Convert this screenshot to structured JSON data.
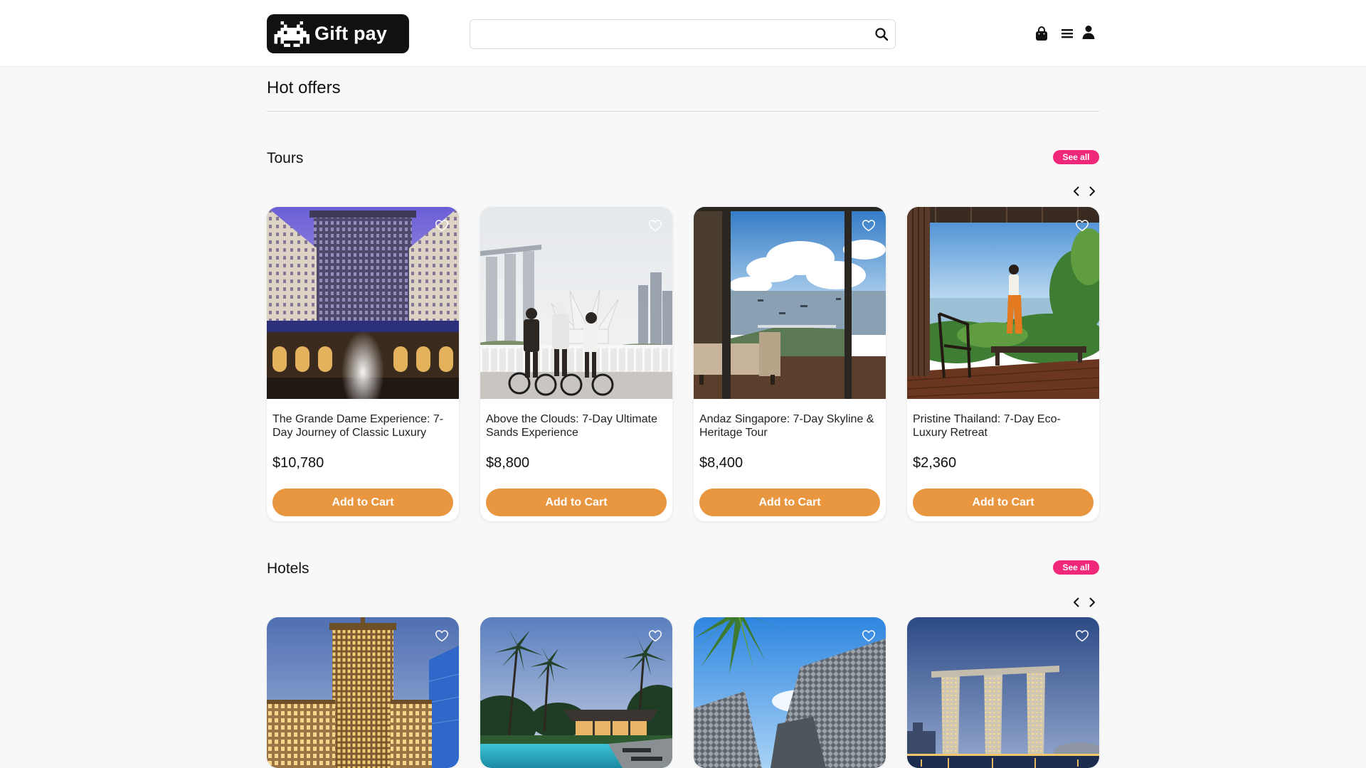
{
  "colors": {
    "accent": "#E8963F",
    "seeall": "#F0287A",
    "bg": "#F8F8F8",
    "logo": "#111111"
  },
  "icons": {
    "logo": "space-invader-icon",
    "search": "search-icon",
    "cart": "shopping-bag-icon",
    "menu": "menu-icon",
    "account": "user-icon",
    "favorite": "heart-icon",
    "prev": "chevron-left-icon",
    "next": "chevron-right-icon"
  },
  "header": {
    "logo_text": "Gift pay",
    "search_value": "",
    "search_placeholder": ""
  },
  "page_title": "Hot offers",
  "tours": {
    "title": "Tours",
    "see_all": "See all",
    "items": [
      {
        "title": "The Grande Dame Experience: 7-Day Journey of Classic Luxury",
        "price": "$10,780",
        "button": "Add to Cart"
      },
      {
        "title": "Above the Clouds: 7-Day Ultimate Sands Experience",
        "price": "$8,800",
        "button": "Add to Cart"
      },
      {
        "title": "Andaz Singapore: 7-Day Skyline & Heritage Tour",
        "price": "$8,400",
        "button": "Add to Cart"
      },
      {
        "title": "Pristine Thailand: 7-Day Eco-Luxury Retreat",
        "price": "$2,360",
        "button": "Add to Cart"
      }
    ]
  },
  "hotels": {
    "title": "Hotels",
    "see_all": "See all"
  }
}
